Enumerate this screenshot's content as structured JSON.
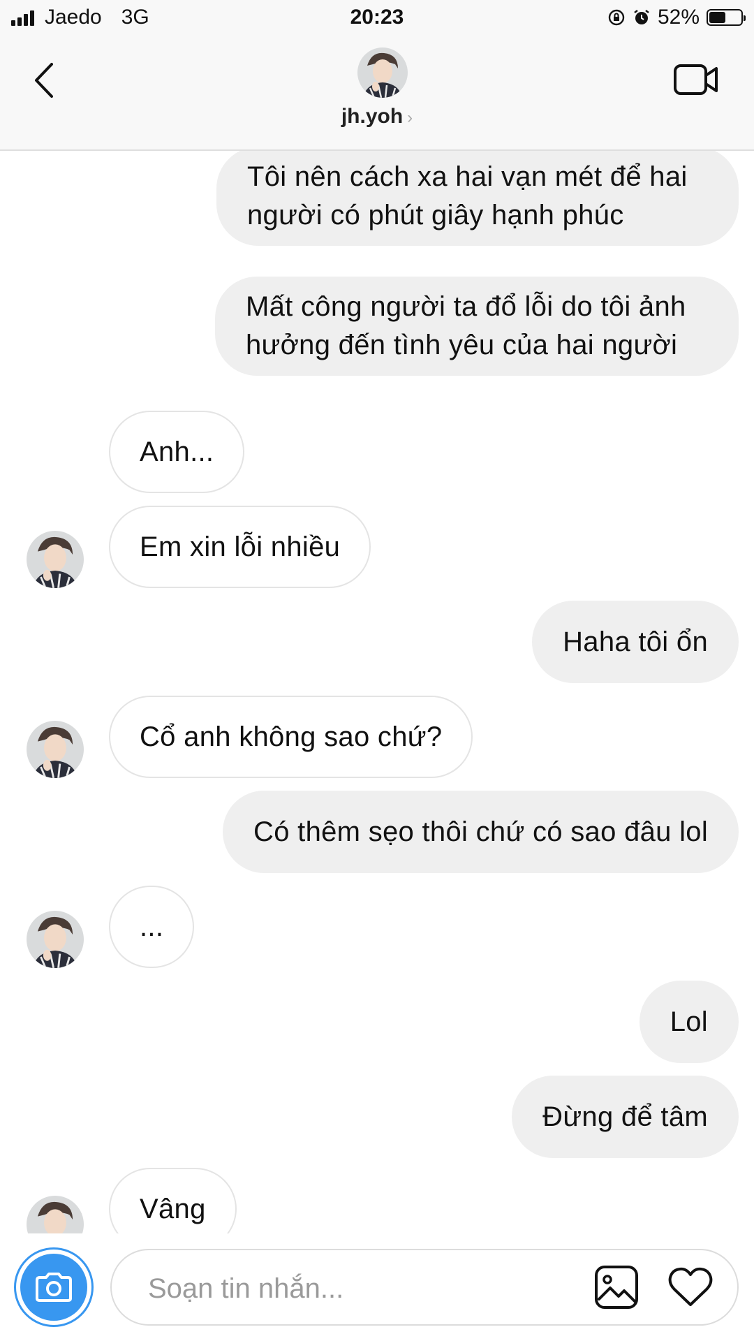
{
  "status_bar": {
    "carrier": "Jaedo",
    "network": "3G",
    "time": "20:23",
    "battery_percent_text": "52%",
    "battery_level": 0.52
  },
  "header": {
    "username": "jh.yoh",
    "chevron": "›"
  },
  "messages": [
    {
      "sender": "me",
      "text": "Tôi nên cách xa hai vạn mét để hai người có phút giây hạnh phúc"
    },
    {
      "sender": "me",
      "text": "Mất công người ta đổ lỗi do tôi ảnh hưởng đến tình yêu của hai người"
    },
    {
      "sender": "them",
      "text": "Anh..."
    },
    {
      "sender": "them",
      "text": "Em xin lỗi nhiều"
    },
    {
      "sender": "me",
      "text": "Haha tôi ổn"
    },
    {
      "sender": "them",
      "text": "Cổ anh không sao chứ?"
    },
    {
      "sender": "me",
      "text": "Có thêm sẹo thôi chứ có sao đâu lol"
    },
    {
      "sender": "them",
      "text": "..."
    },
    {
      "sender": "me",
      "text": "Lol"
    },
    {
      "sender": "me",
      "text": "Đừng để tâm"
    },
    {
      "sender": "them",
      "text": "Vâng"
    }
  ],
  "composer": {
    "placeholder": "Soạn tin nhắn..."
  },
  "icons": {
    "back": "chevron-left-icon",
    "video": "video-camera-icon",
    "camera": "camera-icon",
    "gallery": "image-gallery-icon",
    "heart": "heart-icon"
  },
  "colors": {
    "accent": "#3897f0",
    "my_bubble": "#efefef",
    "their_bubble_border": "#e4e4e4"
  }
}
